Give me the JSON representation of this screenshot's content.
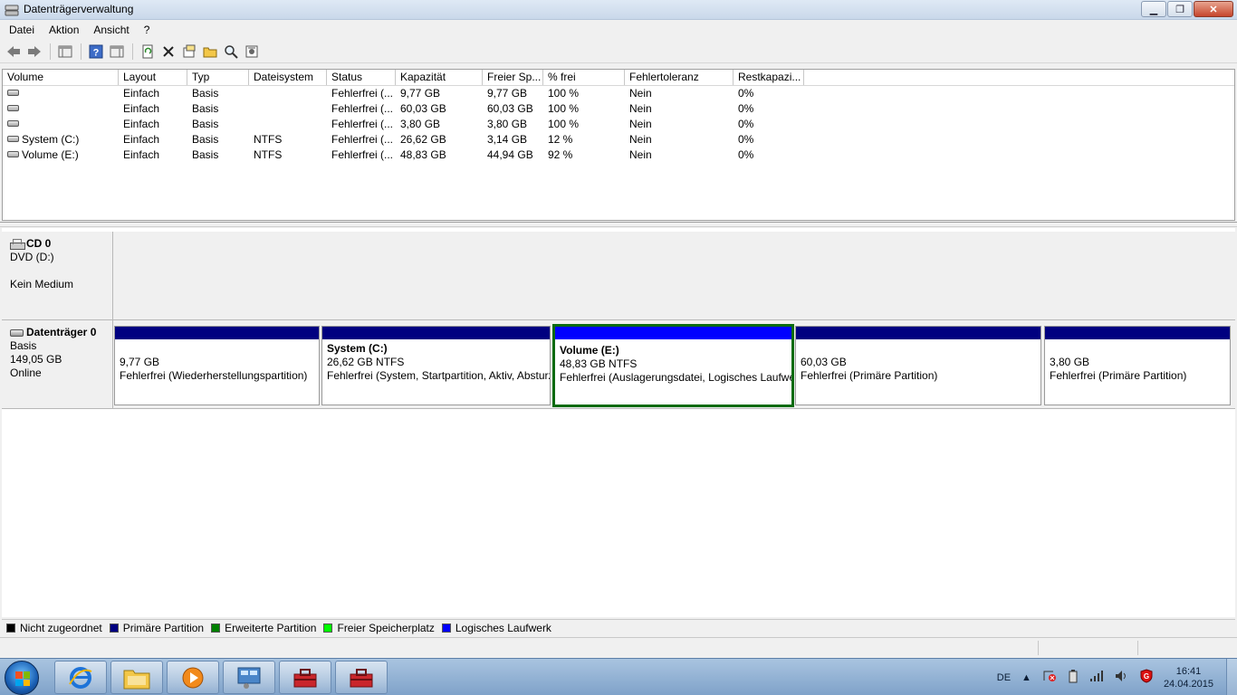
{
  "window": {
    "title": "Datenträgerverwaltung"
  },
  "menu": [
    "Datei",
    "Aktion",
    "Ansicht",
    "?"
  ],
  "toolbar": {
    "icons": [
      "back-icon",
      "forward-icon",
      "console-icon",
      "help-icon",
      "properties-icon",
      "refresh-icon",
      "delete-icon",
      "folder-icon",
      "open-icon",
      "search-icon",
      "settings-icon"
    ]
  },
  "columns": [
    "Volume",
    "Layout",
    "Typ",
    "Dateisystem",
    "Status",
    "Kapazität",
    "Freier Sp...",
    "% frei",
    "Fehlertoleranz",
    "Restkapazi..."
  ],
  "volumes": [
    [
      "",
      "Einfach",
      "Basis",
      "",
      "Fehlerfrei (...",
      "9,77 GB",
      "9,77 GB",
      "100 %",
      "Nein",
      "0%"
    ],
    [
      "",
      "Einfach",
      "Basis",
      "",
      "Fehlerfrei (...",
      "60,03 GB",
      "60,03 GB",
      "100 %",
      "Nein",
      "0%"
    ],
    [
      "",
      "Einfach",
      "Basis",
      "",
      "Fehlerfrei (...",
      "3,80 GB",
      "3,80 GB",
      "100 %",
      "Nein",
      "0%"
    ],
    [
      "System (C:)",
      "Einfach",
      "Basis",
      "NTFS",
      "Fehlerfrei (...",
      "26,62 GB",
      "3,14 GB",
      "12 %",
      "Nein",
      "0%"
    ],
    [
      "Volume (E:)",
      "Einfach",
      "Basis",
      "NTFS",
      "Fehlerfrei (...",
      "48,83 GB",
      "44,94 GB",
      "92 %",
      "Nein",
      "0%"
    ]
  ],
  "cd0": {
    "name": "CD 0",
    "line1": "DVD (D:)",
    "line2": "Kein Medium"
  },
  "disk0": {
    "name": "Datenträger 0",
    "type": "Basis",
    "size": "149,05 GB",
    "state": "Online",
    "partitions": [
      {
        "title": "",
        "size": "9,77 GB",
        "status": "Fehlerfrei (Wiederherstellungspartition)"
      },
      {
        "title": "System  (C:)",
        "size": "26,62 GB NTFS",
        "status": "Fehlerfrei (System, Startpartition, Aktiv, Absturzspeicherabbild, Primäre Partition)"
      },
      {
        "title": "Volume  (E:)",
        "size": "48,83 GB NTFS",
        "status": "Fehlerfrei (Auslagerungsdatei, Logisches Laufwerk)"
      },
      {
        "title": "",
        "size": "60,03 GB",
        "status": "Fehlerfrei (Primäre Partition)"
      },
      {
        "title": "",
        "size": "3,80 GB",
        "status": "Fehlerfrei (Primäre Partition)"
      }
    ]
  },
  "legend": [
    {
      "label": "Nicht zugeordnet",
      "color": "#000000"
    },
    {
      "label": "Primäre Partition",
      "color": "#000080"
    },
    {
      "label": "Erweiterte Partition",
      "color": "#008000"
    },
    {
      "label": "Freier Speicherplatz",
      "color": "#00ff00"
    },
    {
      "label": "Logisches Laufwerk",
      "color": "#0000ff"
    }
  ],
  "taskbar": {
    "apps": [
      "internet-explorer-icon",
      "explorer-folder-icon",
      "media-player-icon",
      "control-panel-icon",
      "toolbox-icon",
      "toolbox-icon"
    ],
    "language": "DE",
    "time": "16:41",
    "date": "24.04.2015"
  }
}
